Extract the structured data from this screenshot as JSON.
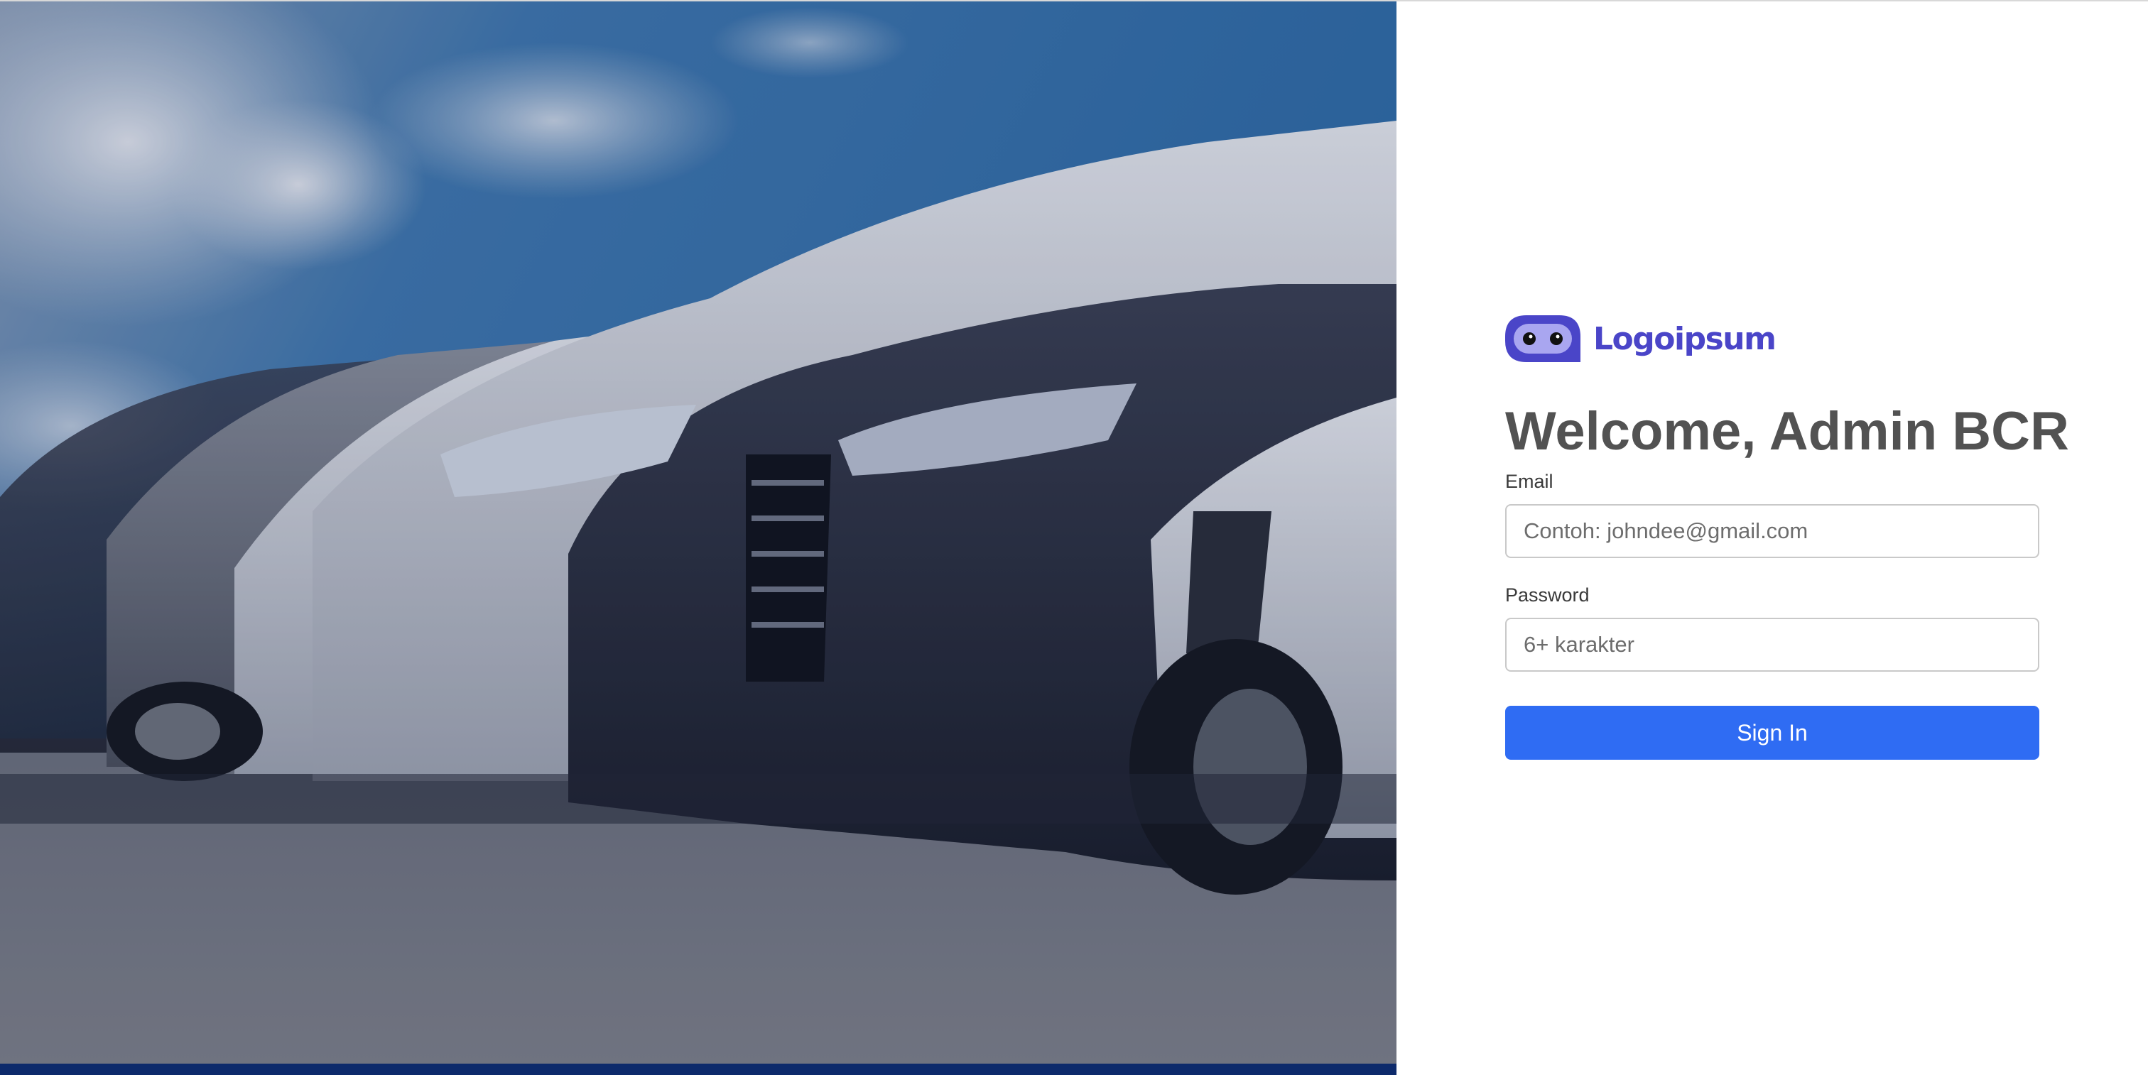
{
  "logo": {
    "text": "Logoipsum",
    "icon": "logo-mascot-icon",
    "color": "#4a45c8"
  },
  "login": {
    "title": "Welcome, Admin BCR",
    "email": {
      "label": "Email",
      "placeholder": "Contoh: johndee@gmail.com",
      "value": ""
    },
    "password": {
      "label": "Password",
      "placeholder": "6+ karakter",
      "value": ""
    },
    "submit_label": "Sign In"
  },
  "hero": {
    "image": "row-of-cars-photo"
  },
  "colors": {
    "primary": "#2f6cf3",
    "title_text": "#525252",
    "hero_bar": "#0d2a6b"
  }
}
